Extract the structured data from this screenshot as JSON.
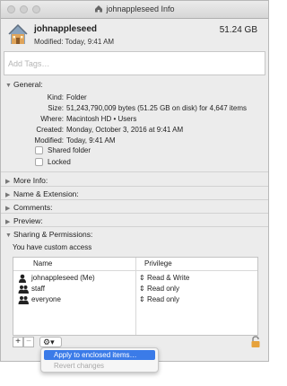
{
  "window": {
    "title": "johnappleseed Info"
  },
  "header": {
    "name": "johnappleseed",
    "modified": "Modified: Today, 9:41 AM",
    "size": "51.24 GB",
    "icon": "home-folder-icon"
  },
  "tags": {
    "placeholder": "Add Tags…",
    "value": ""
  },
  "general": {
    "header": "General:",
    "rows": [
      {
        "label": "Kind:",
        "value": "Folder"
      },
      {
        "label": "Size:",
        "value": "51,243,790,009 bytes (51.25 GB on disk) for 4,647 items"
      },
      {
        "label": "Where:",
        "value": "Macintosh HD • Users"
      },
      {
        "label": "Created:",
        "value": "Monday, October 3, 2016 at 9:41 AM"
      },
      {
        "label": "Modified:",
        "value": "Today, 9:41 AM"
      }
    ],
    "shared_folder": "Shared folder",
    "locked": "Locked"
  },
  "sections": {
    "more_info": "More Info:",
    "name_extension": "Name & Extension:",
    "comments": "Comments:",
    "preview": "Preview:"
  },
  "sharing": {
    "header": "Sharing & Permissions:",
    "notice": "You have custom access",
    "col_name": "Name",
    "col_privilege": "Privilege",
    "rows": [
      {
        "name": "johnappleseed (Me)",
        "privilege": "Read & Write",
        "icon": "user-icon"
      },
      {
        "name": "staff",
        "privilege": "Read only",
        "icon": "group-icon"
      },
      {
        "name": "everyone",
        "privilege": "Read only",
        "icon": "group-icon"
      }
    ],
    "add_label": "+",
    "remove_label": "−",
    "action_label": "⚙▾"
  },
  "menu": {
    "items": [
      {
        "label": "Apply to enclosed items…",
        "state": "selected"
      },
      {
        "label": "Revert changes",
        "state": "disabled"
      }
    ]
  },
  "colors": {
    "selection": "#3b7be8",
    "window_bg": "#ececec",
    "lock": "#e6a23c"
  }
}
